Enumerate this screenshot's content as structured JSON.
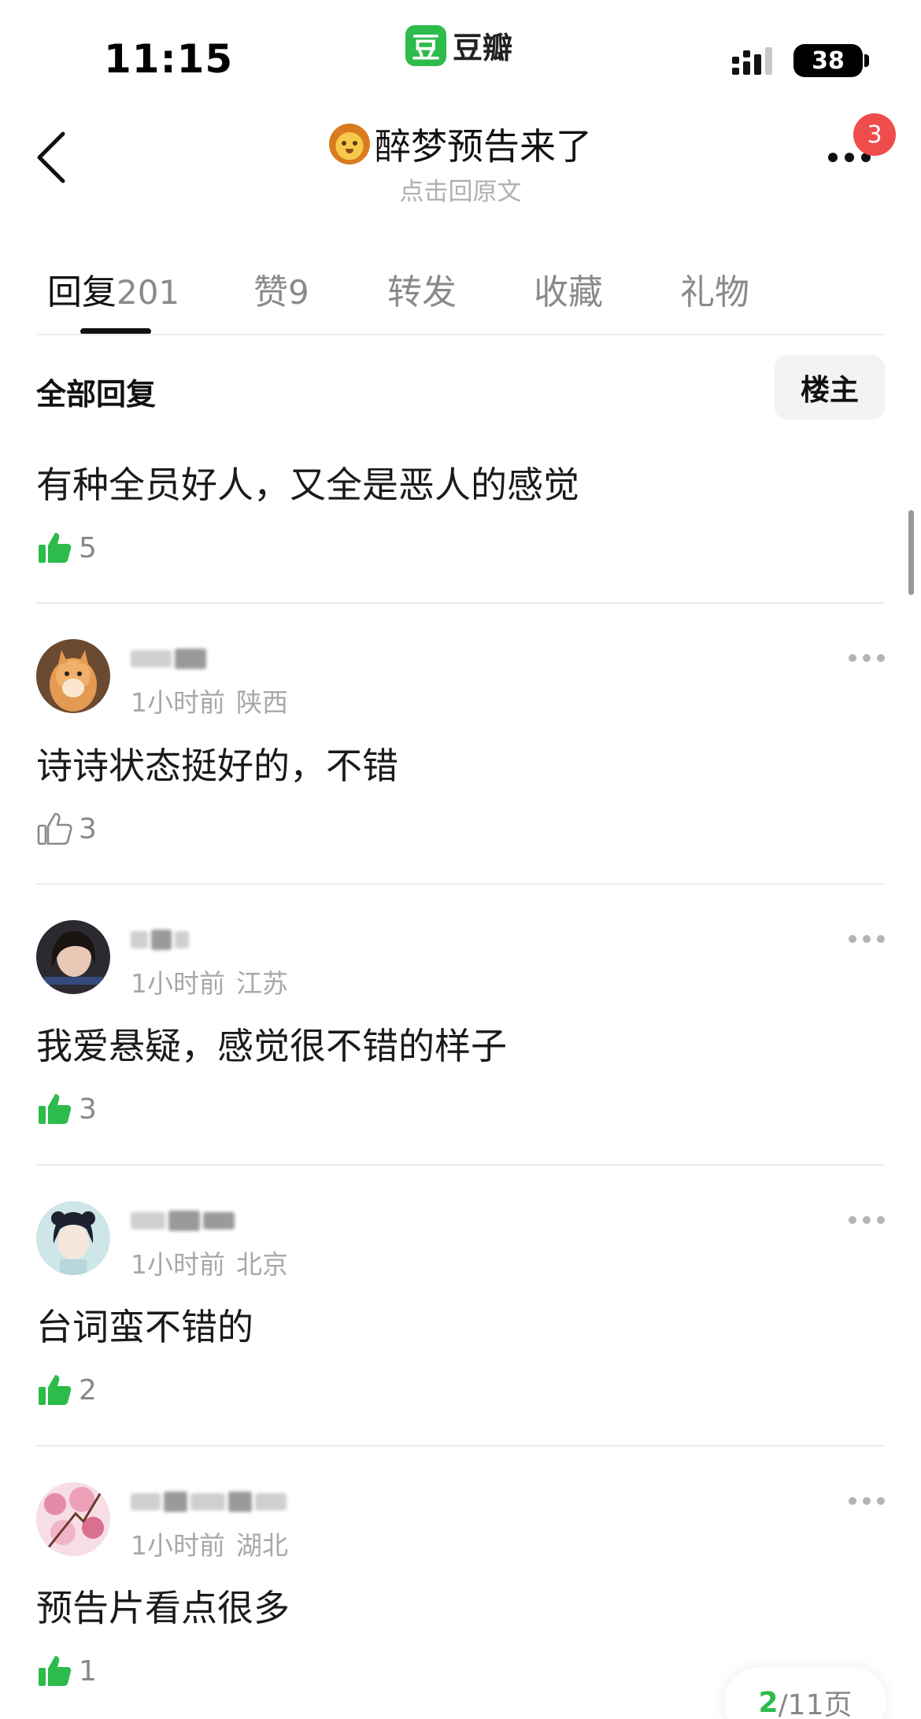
{
  "status_bar": {
    "time": "11:15",
    "app_name": "豆瓣",
    "app_logo_char": "豆",
    "battery": "38"
  },
  "nav": {
    "title": "醉梦预告来了",
    "subtitle": "点击回原文",
    "notification_count": "3"
  },
  "tabs": [
    {
      "label": "回复",
      "count": "201",
      "active": true
    },
    {
      "label": "赞",
      "count": "9",
      "active": false
    },
    {
      "label": "转发",
      "count": "",
      "active": false
    },
    {
      "label": "收藏",
      "count": "",
      "active": false
    },
    {
      "label": "礼物",
      "count": "",
      "active": false
    }
  ],
  "section": {
    "title": "全部回复",
    "op_filter": "楼主"
  },
  "comments": [
    {
      "text": "有种全员好人，又全是恶人的感觉",
      "likes": "5",
      "liked": true
    },
    {
      "time": "1小时前",
      "location": "陕西",
      "text": "诗诗状态挺好的，不错",
      "likes": "3",
      "liked": false,
      "avatar": "cat-avatar"
    },
    {
      "time": "1小时前",
      "location": "江苏",
      "text": "我爱悬疑，感觉很不错的样子",
      "likes": "3",
      "liked": true,
      "avatar": "girl-photo-avatar"
    },
    {
      "time": "1小时前",
      "location": "北京",
      "text": "台词蛮不错的",
      "likes": "2",
      "liked": true,
      "avatar": "anime-girl-avatar"
    },
    {
      "time": "1小时前",
      "location": "湖北",
      "text": "预告片看点很多",
      "likes": "1",
      "liked": true,
      "avatar": "pink-flowers-avatar"
    }
  ],
  "pager": {
    "current": "2",
    "total": "/11页"
  },
  "colors": {
    "brand_green": "#2dbb4b",
    "badge_red": "#f04c4c",
    "like_green": "#2dbb4b"
  }
}
